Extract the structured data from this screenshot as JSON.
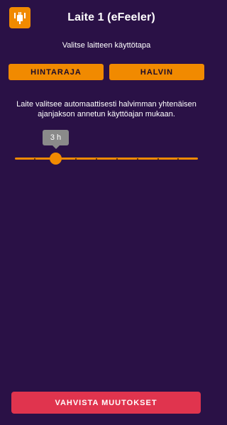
{
  "header": {
    "title": "Laite 1 (eFeeler)",
    "icon": "device-icon"
  },
  "mode": {
    "subtitle": "Valitse laitteen käyttötapa",
    "options": [
      {
        "label": "HINTARAJA"
      },
      {
        "label": "HALVIN"
      }
    ]
  },
  "description": "Laite valitsee automaattisesti halvimman yhtenäisen ajanjakson annetun käyttöajan mukaan.",
  "slider": {
    "value_label": "3 h",
    "value": 3
  },
  "footer": {
    "confirm_label": "VAHVISTA MUUTOKSET"
  },
  "colors": {
    "background": "#2a1146",
    "accent": "#f18a00",
    "confirm": "#e0344e"
  }
}
